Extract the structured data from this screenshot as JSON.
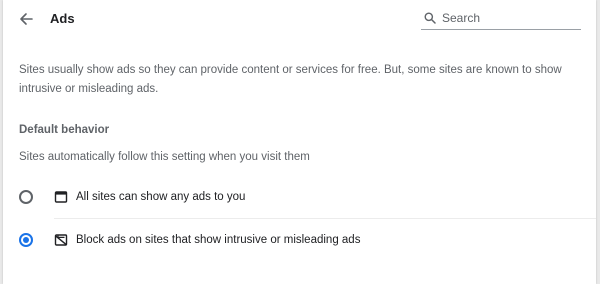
{
  "header": {
    "title": "Ads",
    "back_icon": "arrow-back-icon",
    "search": {
      "icon": "search-icon",
      "placeholder": "Search",
      "value": ""
    }
  },
  "main": {
    "description": "Sites usually show ads so they can provide content or services for free. But, some sites are known to show intrusive or misleading ads.",
    "section_title": "Default behavior",
    "section_subtitle": "Sites automatically follow this setting when you visit them",
    "options": [
      {
        "label": "All sites can show any ads to you",
        "icon": "window-icon",
        "selected": false
      },
      {
        "label": "Block ads on sites that show intrusive or misleading ads",
        "icon": "ads-blocked-icon",
        "selected": true
      }
    ]
  },
  "colors": {
    "accent": "#1a73e8",
    "primary_text": "#202124",
    "secondary_text": "#5f6368"
  }
}
